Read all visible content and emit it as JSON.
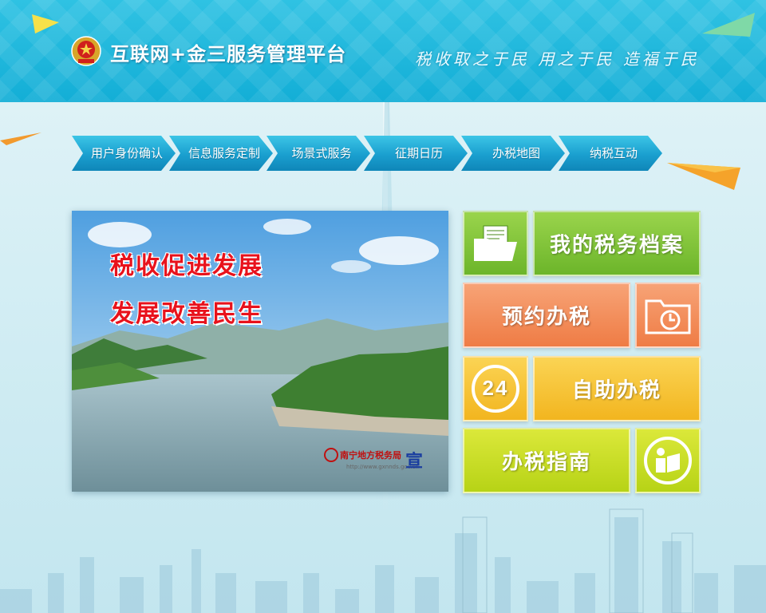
{
  "header": {
    "title": "互联网+金三服务管理平台",
    "slogan": "税收取之于民 用之于民 造福于民",
    "emblem_icon": "tax-emblem-icon"
  },
  "nav": {
    "items": [
      {
        "label": "用户身份确认"
      },
      {
        "label": "信息服务定制"
      },
      {
        "label": "场景式服务"
      },
      {
        "label": "征期日历"
      },
      {
        "label": "办税地图"
      },
      {
        "label": "纳税互动"
      }
    ]
  },
  "banner": {
    "line1": "税收促进发展",
    "line2": "发展改善民生",
    "bureau_name": "南宁地方税务局",
    "bureau_url": "http://www.gxnnds.gov.cn",
    "bureau_char": "宣"
  },
  "tiles": {
    "archive": {
      "label": "我的税务档案",
      "icon": "folder-document-icon"
    },
    "appointment": {
      "label": "预约办税",
      "icon": "folder-clock-icon"
    },
    "self_service": {
      "label": "自助办税",
      "icon": "24-hours-icon",
      "badge": "24"
    },
    "guide": {
      "label": "办税指南",
      "icon": "reading-person-icon"
    }
  },
  "colors": {
    "header": "#13aed6",
    "nav": "#1a9fcf",
    "green": "#6cb52a",
    "orange": "#ef7c45",
    "yellow": "#f2b51f",
    "lime": "#b7d316",
    "banner_text": "#e8121c"
  }
}
